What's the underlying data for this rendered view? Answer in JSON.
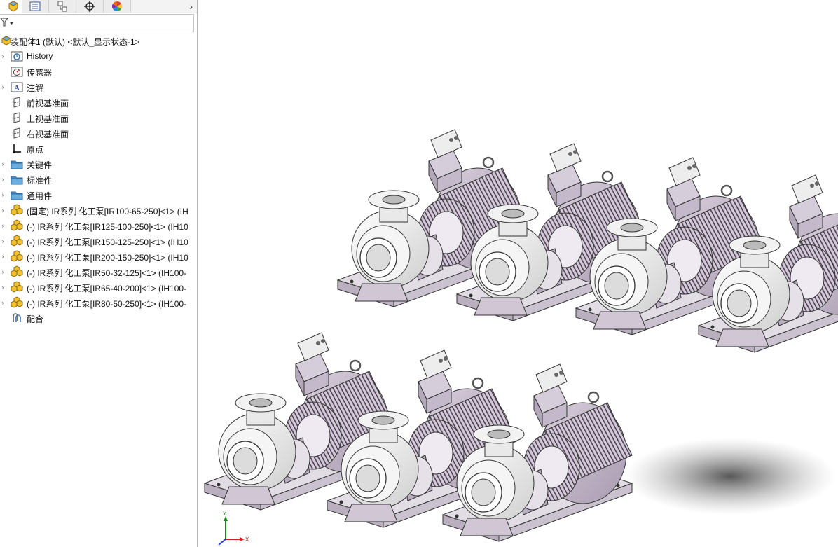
{
  "tabs": [
    {
      "name": "feature-manager",
      "icon": "feature-manager-icon"
    },
    {
      "name": "property-manager",
      "icon": "property-manager-icon"
    },
    {
      "name": "configuration-manager",
      "icon": "configuration-manager-icon"
    },
    {
      "name": "dimxpert-manager",
      "icon": "crosshair-icon"
    },
    {
      "name": "display-manager",
      "icon": "color-wheel-icon"
    }
  ],
  "tab_more": "›",
  "tree": {
    "root": "装配体1 (默认) <默认_显示状态-1>",
    "items": [
      {
        "label": "History",
        "icon": "history-folder-icon",
        "expandable": true
      },
      {
        "label": "传感器",
        "icon": "sensor-folder-icon",
        "expandable": false
      },
      {
        "label": "注解",
        "icon": "annotation-folder-icon",
        "expandable": true
      },
      {
        "label": "前视基准面",
        "icon": "plane-icon",
        "expandable": false
      },
      {
        "label": "上视基准面",
        "icon": "plane-icon",
        "expandable": false
      },
      {
        "label": "右视基准面",
        "icon": "plane-icon",
        "expandable": false
      },
      {
        "label": "原点",
        "icon": "origin-icon",
        "expandable": false
      },
      {
        "label": "关键件",
        "icon": "folder-icon",
        "expandable": true
      },
      {
        "label": "标准件",
        "icon": "folder-icon",
        "expandable": true
      },
      {
        "label": "通用件",
        "icon": "folder-icon",
        "expandable": true
      },
      {
        "label": "(固定) IR系列 化工泵[IR100-65-250]<1> (IH",
        "icon": "subassembly-icon",
        "expandable": true
      },
      {
        "label": "(-) IR系列 化工泵[IR125-100-250]<1> (IH10",
        "icon": "subassembly-icon",
        "expandable": true
      },
      {
        "label": "(-) IR系列 化工泵[IR150-125-250]<1> (IH10",
        "icon": "subassembly-icon",
        "expandable": true
      },
      {
        "label": "(-) IR系列 化工泵[IR200-150-250]<1> (IH10",
        "icon": "subassembly-icon",
        "expandable": true
      },
      {
        "label": "(-) IR系列 化工泵[IR50-32-125]<1> (IH100-",
        "icon": "subassembly-icon",
        "expandable": true
      },
      {
        "label": "(-) IR系列 化工泵[IR65-40-200]<1> (IH100-",
        "icon": "subassembly-icon",
        "expandable": true
      },
      {
        "label": "(-) IR系列 化工泵[IR80-50-250]<1> (IH100-",
        "icon": "subassembly-icon",
        "expandable": true
      },
      {
        "label": "配合",
        "icon": "mates-icon",
        "expandable": false
      }
    ]
  },
  "colors": {
    "motor": "#c7bccc",
    "motor_shade": "#a89bb0",
    "base": "#d9d2dd",
    "pump": "#eeeeee",
    "folder": "#4a90c8"
  },
  "triad_labels": {
    "y": "Y",
    "x": "X"
  }
}
